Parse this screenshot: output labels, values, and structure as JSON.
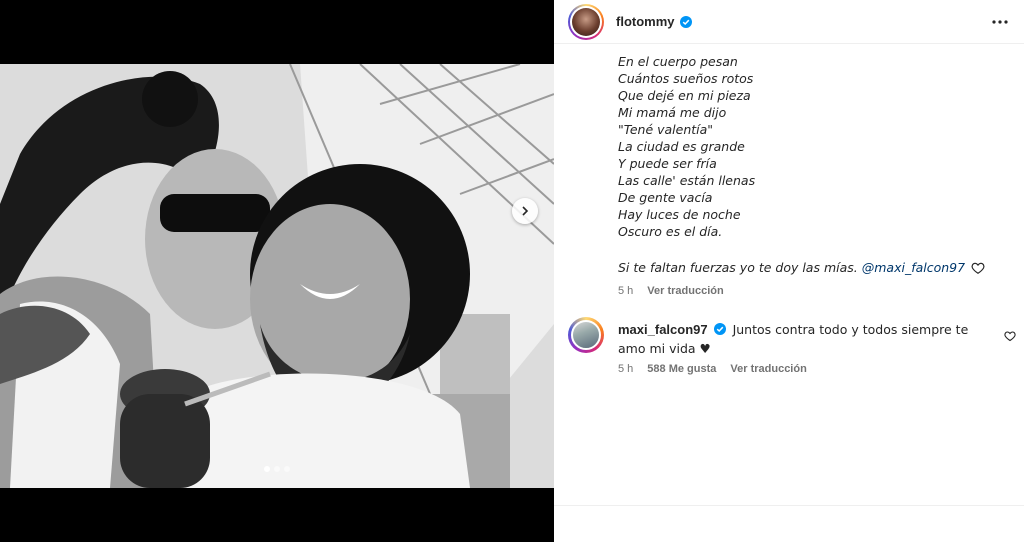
{
  "post": {
    "username": "flotommy",
    "caption_lines": [
      "En el cuerpo pesan",
      "Cuántos sueños rotos",
      "Que dejé en mi pieza",
      "Mi mamá me dijo",
      "\"Tené valentía\"",
      "La ciudad es grande",
      "Y puede ser fría",
      "Las calle' están llenas",
      "De gente vacía",
      "Hay luces de noche",
      "Oscuro es el día."
    ],
    "caption_final_text": "Si te faltan fuerzas yo te doy las mías.",
    "caption_mention": "@maxi_falcon97",
    "time": "5 h",
    "see_translation": "Ver traducción"
  },
  "carousel": {
    "total": 3,
    "current": 1
  },
  "comment": {
    "username": "maxi_falcon97",
    "text": "Juntos contra todo y todos siempre te amo mi vida ♥",
    "time": "5 h",
    "likes": "588 Me gusta",
    "see_translation": "Ver traducción"
  },
  "icons": {
    "more": "more-horizontal-icon",
    "verified": "verified-badge-icon",
    "heart": "heart-outline-icon",
    "next": "chevron-right-icon"
  },
  "colors": {
    "verified": "#0095f6",
    "mention": "#00376b",
    "meta": "#737373"
  }
}
